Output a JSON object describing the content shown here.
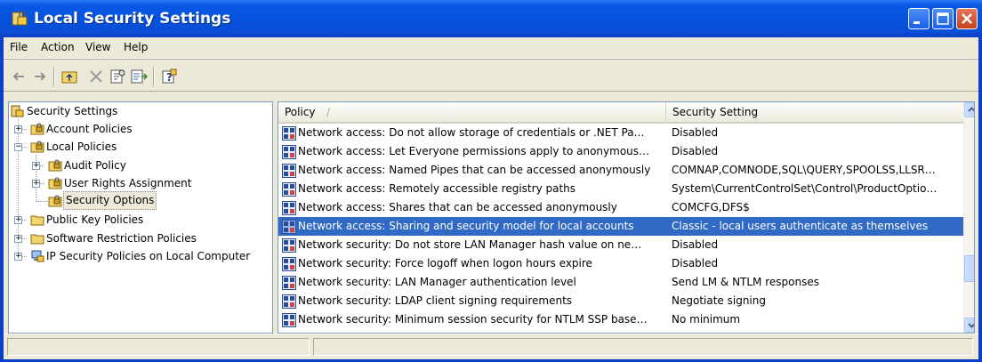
{
  "window": {
    "title": "Local Security Settings"
  },
  "menu": [
    "File",
    "Action",
    "View",
    "Help"
  ],
  "toolbar": {
    "icons": [
      "back-arrow-icon",
      "forward-arrow-icon",
      "up-folder-icon",
      "delete-icon",
      "properties-icon",
      "export-list-icon",
      "help-icon"
    ]
  },
  "tree": [
    {
      "label": "Security Settings",
      "icon": "security-settings-icon"
    },
    {
      "label": "Account Policies",
      "icon": "folder-lock-icon"
    },
    {
      "label": "Local Policies",
      "icon": "folder-lock-icon"
    },
    {
      "label": "Audit Policy",
      "icon": "folder-lock-icon"
    },
    {
      "label": "User Rights Assignment",
      "icon": "folder-lock-icon"
    },
    {
      "label": "Security Options",
      "icon": "folder-lock-icon",
      "selected": true
    },
    {
      "label": "Public Key Policies",
      "icon": "folder-icon"
    },
    {
      "label": "Software Restriction Policies",
      "icon": "folder-icon"
    },
    {
      "label": "IP Security Policies on Local Computer",
      "icon": "ip-security-icon"
    }
  ],
  "table": {
    "columns": [
      "Policy",
      "Security Setting"
    ],
    "sort_indicator": "/",
    "rows": [
      {
        "policy": "Network access: Do not allow storage of credentials or .NET Pa…",
        "setting": "Disabled"
      },
      {
        "policy": "Network access: Let Everyone permissions apply to anonymous…",
        "setting": "Disabled"
      },
      {
        "policy": "Network access: Named Pipes that can be accessed anonymously",
        "setting": "COMNAP,COMNODE,SQL\\QUERY,SPOOLSS,LLSR…"
      },
      {
        "policy": "Network access: Remotely accessible registry paths",
        "setting": "System\\CurrentControlSet\\Control\\ProductOptio…"
      },
      {
        "policy": "Network access: Shares that can be accessed anonymously",
        "setting": "COMCFG,DFS$"
      },
      {
        "policy": "Network access: Sharing and security model for local accounts",
        "setting": "Classic - local users authenticate as themselves",
        "selected": true
      },
      {
        "policy": "Network security: Do not store LAN Manager hash value on ne…",
        "setting": "Disabled"
      },
      {
        "policy": "Network security: Force logoff when logon hours expire",
        "setting": "Disabled"
      },
      {
        "policy": "Network security: LAN Manager authentication level",
        "setting": "Send LM & NTLM responses"
      },
      {
        "policy": "Network security: LDAP client signing requirements",
        "setting": "Negotiate signing"
      },
      {
        "policy": "Network security: Minimum session security for NTLM SSP base…",
        "setting": "No minimum"
      }
    ]
  },
  "colors": {
    "selection": "#316ac5",
    "titlebar": "#0553dc",
    "chrome": "#ece9d8"
  }
}
